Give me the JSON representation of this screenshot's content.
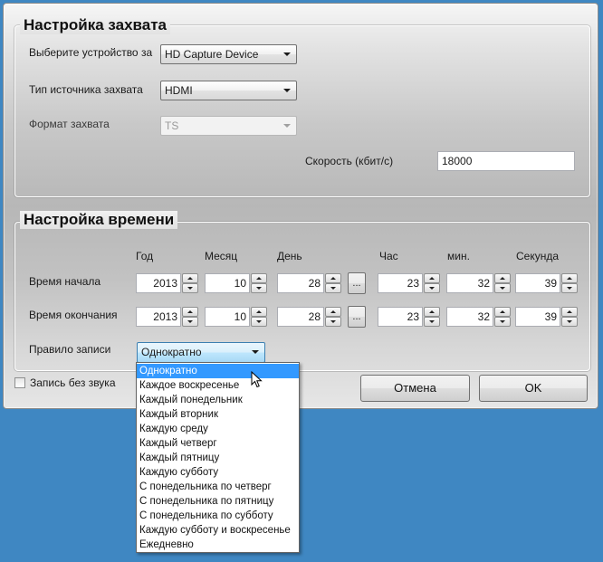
{
  "capture": {
    "title": "Настройка захвата",
    "device_label": "Выберите устройство за",
    "device_value": "HD Capture Device",
    "source_label": "Тип источника захвата",
    "source_value": "HDMI",
    "format_label": "Формат захвата",
    "format_value": "TS",
    "speed_label": "Скорость (кбит/с)",
    "speed_value": "18000"
  },
  "time": {
    "title": "Настройка времени",
    "headers": {
      "year": "Год",
      "month": "Месяц",
      "day": "День",
      "hour": "Час",
      "minute": "мин.",
      "second": "Секунда"
    },
    "start": {
      "label": "Время начала",
      "year": "2013",
      "month": "10",
      "day": "28",
      "hour": "23",
      "minute": "32",
      "second": "39",
      "picker": "..."
    },
    "end": {
      "label": "Время окончания",
      "year": "2013",
      "month": "10",
      "day": "28",
      "hour": "23",
      "minute": "32",
      "second": "39",
      "picker": "..."
    },
    "rule_label": "Правило записи",
    "rule_value": "Однократно"
  },
  "mute_label": "Запись без звука",
  "buttons": {
    "cancel": "Отмена",
    "ok": "OK"
  },
  "dropdown": {
    "selected_index": 0,
    "options": [
      "Однократно",
      "Каждое воскресенье",
      "Каждый понедельник",
      "Каждый вторник",
      "Каждую среду",
      "Каждый четверг",
      "Каждый пятницу",
      "Каждую субботу",
      "С понедельника по четверг",
      "С понедельника по пятницу",
      "С понедельника по субботу",
      "Каждую субботу и воскресенье",
      "Ежедневно"
    ]
  },
  "colors": {
    "desktop": "#3f87c2",
    "highlight": "#3399ff"
  }
}
